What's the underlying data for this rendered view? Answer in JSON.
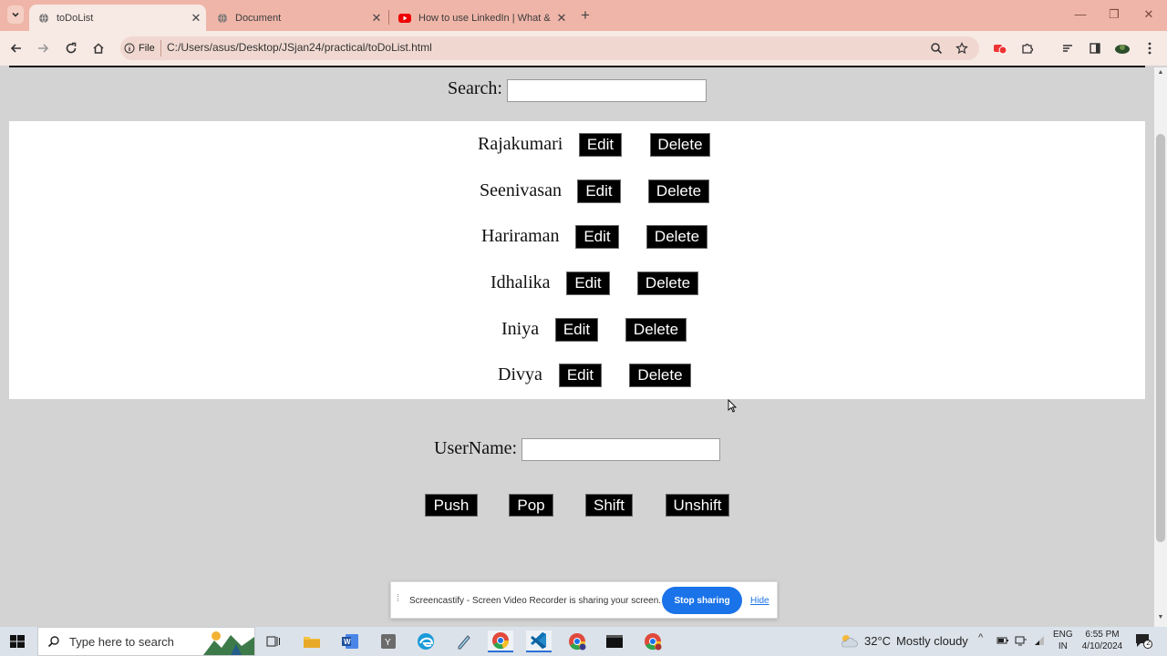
{
  "browser": {
    "tabs": [
      {
        "title": "toDoList",
        "icon": "globe-icon",
        "active": true
      },
      {
        "title": "Document",
        "icon": "globe-icon",
        "active": false
      },
      {
        "title": "How to use LinkedIn | What & W",
        "icon": "youtube-icon",
        "active": false
      }
    ],
    "new_tab": "+",
    "file_chip": "File",
    "url": "C:/Users/asus/Desktop/JSjan24/practical/toDoList.html"
  },
  "page": {
    "search_label": "Search:",
    "search_value": "",
    "items": [
      {
        "name": "Rajakumari",
        "edit": "Edit",
        "delete": "Delete"
      },
      {
        "name": "Seenivasan",
        "edit": "Edit",
        "delete": "Delete"
      },
      {
        "name": "Hariraman",
        "edit": "Edit",
        "delete": "Delete"
      },
      {
        "name": "Idhalika",
        "edit": "Edit",
        "delete": "Delete"
      },
      {
        "name": "Iniya",
        "edit": "Edit",
        "delete": "Delete"
      },
      {
        "name": "Divya",
        "edit": "Edit",
        "delete": "Delete"
      }
    ],
    "username_label": "UserName:",
    "username_value": "",
    "actions": {
      "push": "Push",
      "pop": "Pop",
      "shift": "Shift",
      "unshift": "Unshift"
    }
  },
  "share_banner": {
    "text": "Screencastify - Screen Video Recorder is sharing your screen.",
    "stop": "Stop sharing",
    "hide": "Hide"
  },
  "taskbar": {
    "search_placeholder": "Type here to search",
    "weather_temp": "32°C",
    "weather_desc": "Mostly cloudy",
    "lang_top": "ENG",
    "lang_bottom": "IN",
    "time": "6:55 PM",
    "date": "4/10/2024",
    "notification_count": "2"
  },
  "colors": {
    "tab_strip": "#efb5a8",
    "toolbar": "#f7e9e4",
    "page_bg": "#d3d3d3",
    "button_bg": "#000000",
    "accent": "#1a73e8"
  }
}
